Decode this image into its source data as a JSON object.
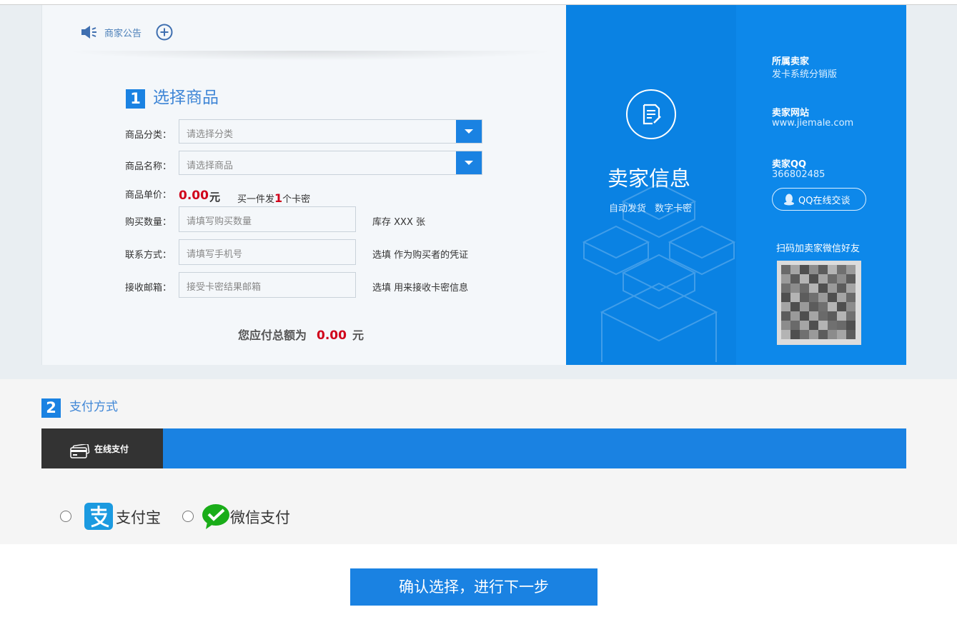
{
  "notice": {
    "label": "商家公告"
  },
  "step1": {
    "number": "1",
    "title": "选择商品"
  },
  "form": {
    "category": {
      "label": "商品分类：",
      "placeholder": "请选择分类"
    },
    "product": {
      "label": "商品名称：",
      "placeholder": "请选择商品"
    },
    "price": {
      "label": "商品单价：",
      "value": "0.00",
      "unit": "元",
      "note_prefix": "买一件发",
      "note_count": "1",
      "note_suffix": "个卡密"
    },
    "quantity": {
      "label": "购买数量：",
      "placeholder": "请填写购买数量",
      "hint": "库存 XXX 张"
    },
    "contact": {
      "label": "联系方式：",
      "placeholder": "请填写手机号",
      "hint": "选填 作为购买者的凭证"
    },
    "email": {
      "label": "接收邮箱：",
      "placeholder": "接受卡密结果邮箱",
      "hint": "选填 用来接收卡密信息"
    },
    "total": {
      "label": "您应付总额为",
      "value": "0.00",
      "unit": "元"
    }
  },
  "seller": {
    "title": "卖家信息",
    "subtitle": "自动发货 数字卡密",
    "belong_label": "所属卖家",
    "belong_value": "发卡系统分销版",
    "site_label": "卖家网站",
    "site_value": "www.jiemale.com",
    "qq_label": "卖家QQ",
    "qq_value": "366802485",
    "qq_button": "QQ在线交谈",
    "scan_title": "扫码加卖家微信好友"
  },
  "step2": {
    "number": "2",
    "title": "支付方式"
  },
  "payment": {
    "tab": "在线支付",
    "options": [
      {
        "name": "支付宝",
        "icon": "alipay-icon",
        "color": "#1b9ae0"
      },
      {
        "name": "微信支付",
        "icon": "wechat-pay-icon",
        "color": "#1aad19"
      }
    ]
  },
  "confirm_button": "确认选择，进行下一步",
  "colors": {
    "primary": "#1a82e2",
    "price": "#d0021b",
    "seller_panel": "#0d88ea",
    "dark_tab": "#333333"
  }
}
